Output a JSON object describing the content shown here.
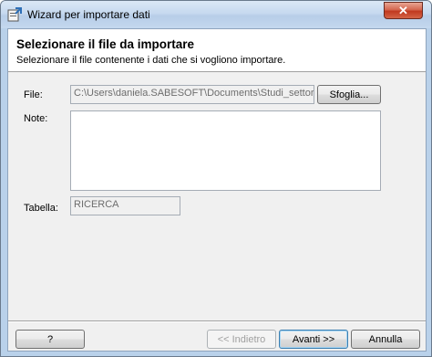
{
  "window": {
    "title": "Wizard per importare dati",
    "close_glyph": "✕"
  },
  "header": {
    "title": "Selezionare il file da importare",
    "subtitle": "Selezionare il file contenente i dati che si vogliono importare."
  },
  "form": {
    "file_label": "File:",
    "file_value": "C:\\Users\\daniela.SABESOFT\\Documents\\Studi_settore",
    "browse_label": "Sfoglia...",
    "note_label": "Note:",
    "note_value": "",
    "table_label": "Tabella:",
    "table_value": "RICERCA"
  },
  "footer": {
    "help_label": "?",
    "back_label": "<< Indietro",
    "next_label": "Avanti >>",
    "cancel_label": "Annulla"
  }
}
